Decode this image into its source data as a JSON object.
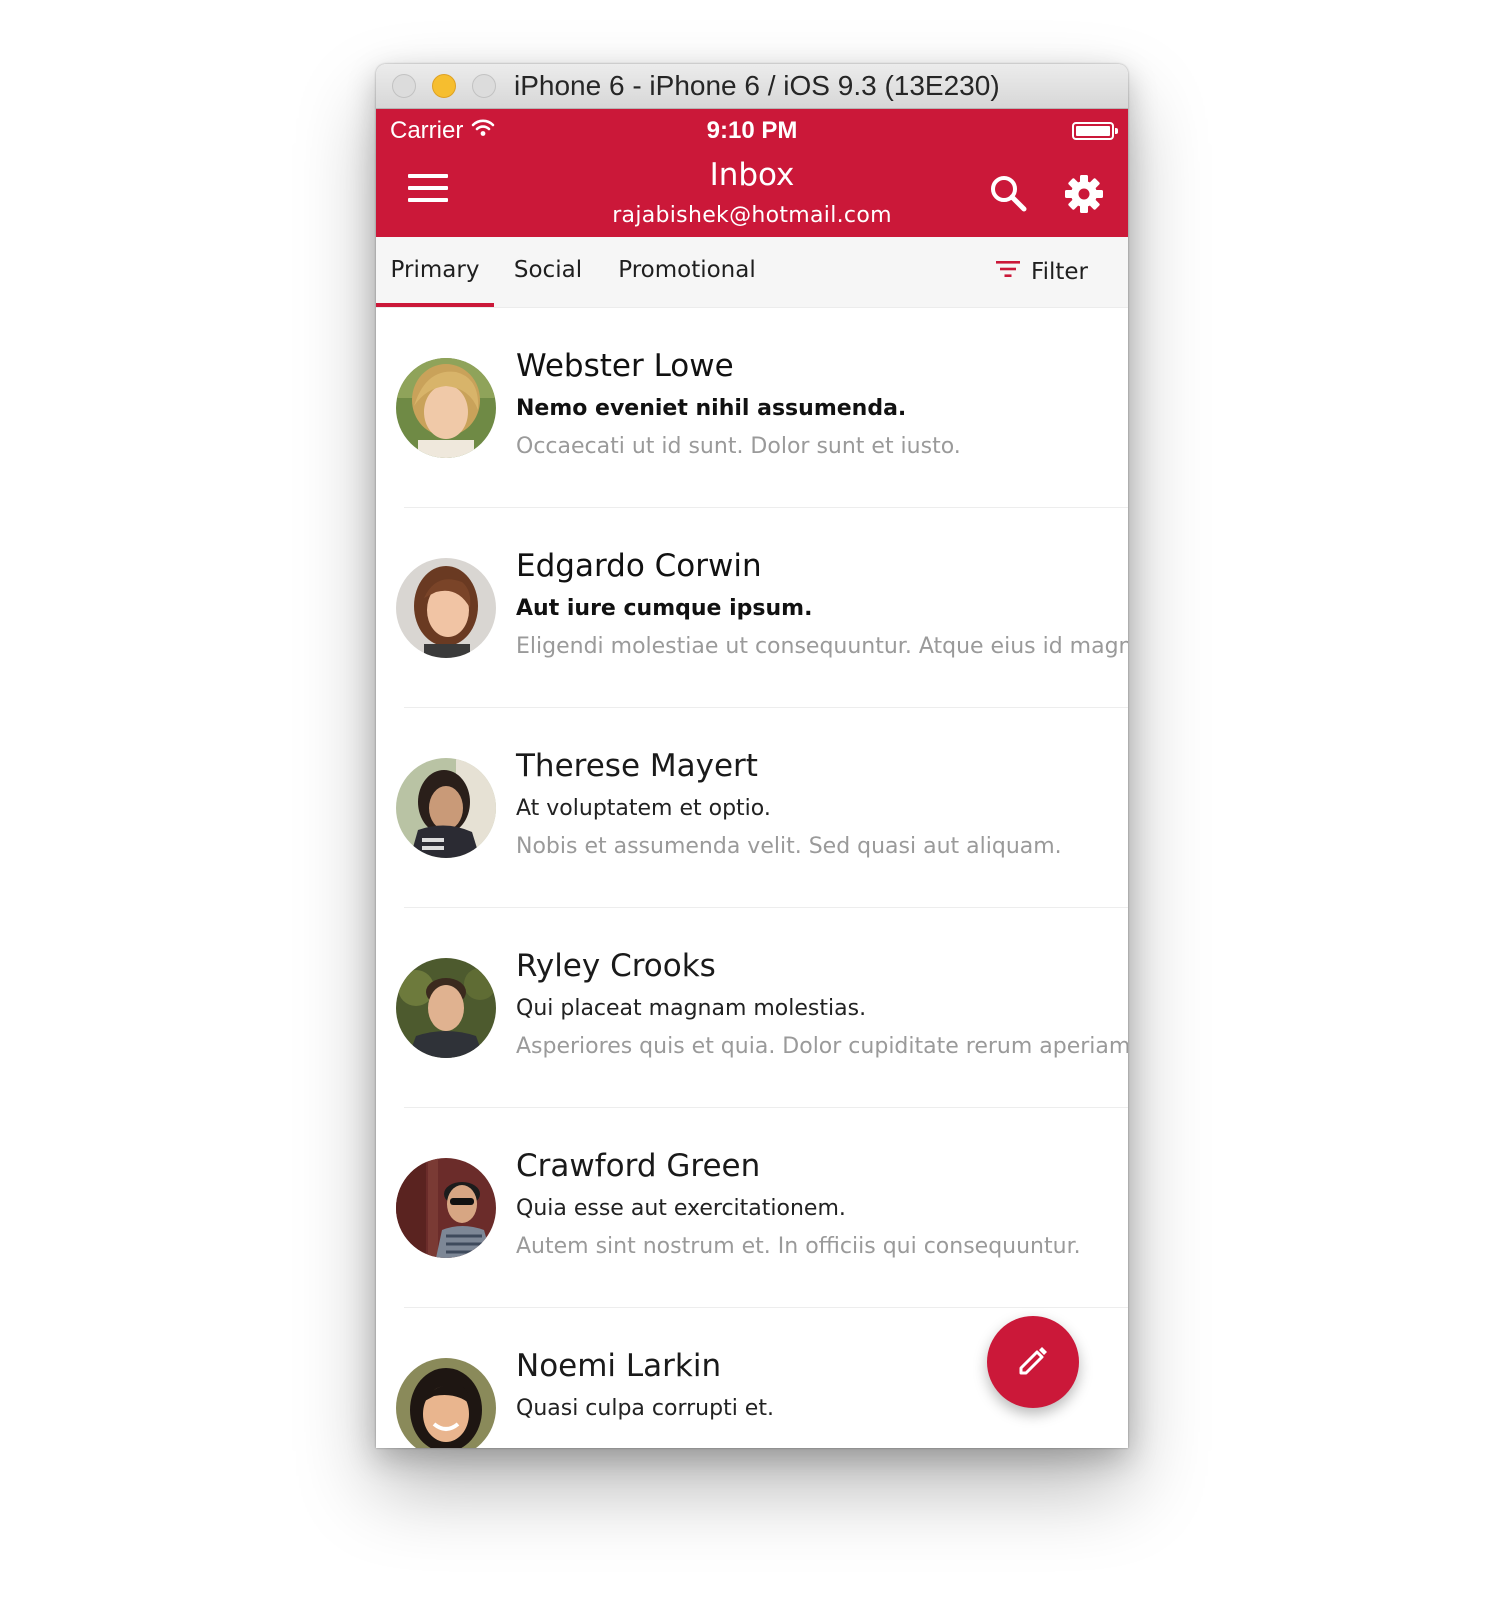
{
  "window": {
    "title": "iPhone 6 - iPhone 6 / iOS 9.3 (13E230)"
  },
  "status_bar": {
    "carrier": "Carrier",
    "time": "9:10 PM",
    "battery_level": 1.0
  },
  "header": {
    "title": "Inbox",
    "account": "rajabishek@hotmail.com",
    "icons": [
      "menu-icon",
      "search-icon",
      "settings-icon"
    ]
  },
  "tabs": [
    {
      "label": "Primary",
      "selected": true
    },
    {
      "label": "Social",
      "selected": false
    },
    {
      "label": "Promotional",
      "selected": false
    }
  ],
  "filter": {
    "label": "Filter",
    "icon": "filter-icon"
  },
  "messages": [
    {
      "sender": "Webster Lowe",
      "subject": "Nemo eveniet nihil assumenda.",
      "preview": "Occaecati ut id sunt. Dolor sunt et iusto.",
      "unread": true
    },
    {
      "sender": "Edgardo Corwin",
      "subject": "Aut iure cumque ipsum.",
      "preview": "Eligendi molestiae ut consequuntur. Atque eius id magna",
      "unread": true
    },
    {
      "sender": "Therese Mayert",
      "subject": "At voluptatem et optio.",
      "preview": "Nobis et assumenda velit. Sed quasi aut aliquam.",
      "unread": false
    },
    {
      "sender": "Ryley Crooks",
      "subject": "Qui placeat magnam molestias.",
      "preview": "Asperiores quis et quia. Dolor cupiditate rerum aperiam.",
      "unread": false
    },
    {
      "sender": "Crawford Green",
      "subject": "Quia esse aut exercitationem.",
      "preview": "Autem sint nostrum et. In officiis qui consequuntur.",
      "unread": false
    },
    {
      "sender": "Noemi Larkin",
      "subject": "Quasi culpa corrupti et.",
      "preview": "",
      "unread": false
    }
  ],
  "fab": {
    "icon": "pencil-icon"
  },
  "colors": {
    "accent": "#cb1839",
    "tab_bar": "#f6f6f6",
    "preview_text": "#9a9a9a"
  }
}
